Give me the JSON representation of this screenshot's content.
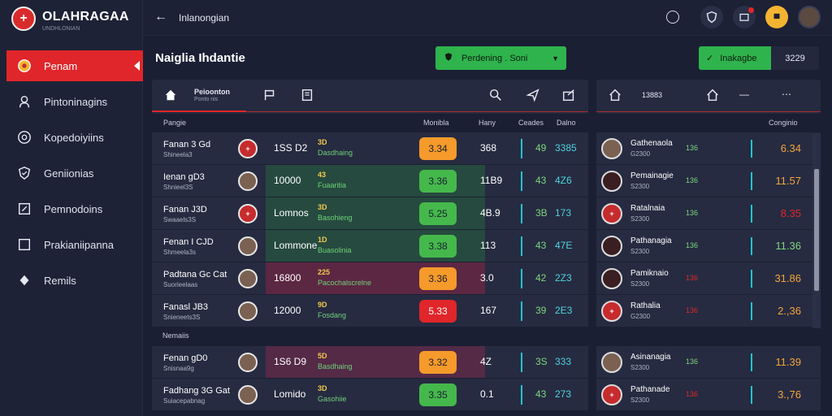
{
  "brand": {
    "name": "OLAHRAGAA",
    "tagline": "UNDHLONIAN"
  },
  "sidebar": {
    "items": [
      {
        "label": "Penam",
        "icon": "ball-icon",
        "active": true
      },
      {
        "label": "Pintoninagins",
        "icon": "user-icon",
        "active": false
      },
      {
        "label": "Kopedoiyiins",
        "icon": "soccer-icon",
        "active": false
      },
      {
        "label": "Geniionias",
        "icon": "shield-icon",
        "active": false
      },
      {
        "label": "Pemnodoins",
        "icon": "edit-icon",
        "active": false
      },
      {
        "label": "Prakianiipanna",
        "icon": "square-icon",
        "active": false
      },
      {
        "label": "Remils",
        "icon": "diamond-icon",
        "active": false
      }
    ]
  },
  "topbar": {
    "title": "Inlanongian"
  },
  "header": {
    "title": "Naiglia Ihdantie",
    "filter_label": "Perdening . Soni",
    "odds_label": "Inakagbe",
    "odds_value": "3229"
  },
  "tabs": {
    "active_label": "Peioonton",
    "active_sub": "Ponto nis"
  },
  "columns": {
    "name": "Pangie",
    "c1": "Monibla",
    "c2": "Hany",
    "c3": "Ceades",
    "c4": "Dalno",
    "right_head": "Conginio"
  },
  "right_tab_value": "13883",
  "rows": [
    {
      "name": "Fanan 3 Gd",
      "sub": "Shineela3",
      "badge": "red",
      "score": "1SS D2",
      "tag": "3D",
      "tag2": "Dasdhaing",
      "pill": "3.34",
      "pill_color": "orange",
      "v1": "368",
      "v2": "49",
      "v3": "3385",
      "hl": ""
    },
    {
      "name": "Ienan gD3",
      "sub": "Shnieel3S",
      "badge": "face",
      "score": "10000",
      "tag": "43",
      "tag2": "Fuaaritia",
      "pill": "3.36",
      "pill_color": "green",
      "v1": "11B9",
      "v2": "43",
      "v3": "4Z6",
      "hl": "green"
    },
    {
      "name": "Fanan J3D",
      "sub": "Swaaels3S",
      "badge": "red",
      "score": "Lomnos",
      "tag": "3D",
      "tag2": "Basohieng",
      "pill": "5.25",
      "pill_color": "green",
      "v1": "4B.9",
      "v2": "3B",
      "v3": "173",
      "hl": "green"
    },
    {
      "name": "Fenan I CJD",
      "sub": "Shmeela3s",
      "badge": "face",
      "score": "Lommone",
      "tag": "1D",
      "tag2": "Buasolinia",
      "pill": "3.38",
      "pill_color": "green",
      "v1": "113",
      "v2": "43",
      "v3": "47E",
      "hl": "green"
    },
    {
      "name": "Padtana Gc Cat",
      "sub": "Suorieelaas",
      "badge": "face",
      "score": "16800",
      "tag": "225",
      "tag2": "Pacochalscrelne",
      "pill": "3.36",
      "pill_color": "orange",
      "v1": "3.0",
      "v2": "42",
      "v3": "2Z3",
      "hl": "magenta"
    },
    {
      "name": "Fanasl JB3",
      "sub": "Snieneets3S",
      "badge": "face",
      "score": "12000",
      "tag": "9D",
      "tag2": "Fosdang",
      "pill": "5.33",
      "pill_color": "red",
      "v1": "167",
      "v2": "39",
      "v3": "2E3",
      "hl": ""
    }
  ],
  "section_label": "Nemaiis",
  "rows2": [
    {
      "name": "Fenan gD0",
      "sub": "Snisnaa9g",
      "badge": "face",
      "score": "1S6 D9",
      "tag": "5D",
      "tag2": "Basdhaing",
      "pill": "3.32",
      "pill_color": "orange",
      "v1": "4Z",
      "v2": "3S",
      "v3": "333",
      "hl": "plum"
    },
    {
      "name": "Fadhang 3G Gat",
      "sub": "Suiacepabnag",
      "badge": "face",
      "score": "Lomido",
      "tag": "3D",
      "tag2": "Gasohiie",
      "pill": "3.35",
      "pill_color": "green",
      "v1": "0.1",
      "v2": "43",
      "v3": "273",
      "hl": ""
    }
  ],
  "right_rows": [
    {
      "name": "Gathenaola",
      "sub": "G2300",
      "badge": "face",
      "val": "136",
      "val_color": "#7ed67d",
      "num": "6.34",
      "num_color": "#f5a43a"
    },
    {
      "name": "Pemainagie",
      "sub": "S2300",
      "badge": "dark",
      "val": "136",
      "val_color": "#7ed67d",
      "num": "11.57",
      "num_color": "#f5a43a"
    },
    {
      "name": "Ratalnaia",
      "sub": "S2300",
      "badge": "red",
      "val": "136",
      "val_color": "#7ed67d",
      "num": "8.35",
      "num_color": "#e0262a"
    },
    {
      "name": "Pathanagia",
      "sub": "S2300",
      "badge": "dark",
      "val": "136",
      "val_color": "#7ed67d",
      "num": "11.36",
      "num_color": "#7ed67d"
    },
    {
      "name": "Pamiknaio",
      "sub": "S2300",
      "badge": "dark",
      "val": "136",
      "val_color": "#e0262a",
      "num": "31.86",
      "num_color": "#f5a43a"
    },
    {
      "name": "Rathalia",
      "sub": "G2300",
      "badge": "red",
      "val": "136",
      "val_color": "#e0262a",
      "num": "2.,36",
      "num_color": "#f5a43a"
    }
  ],
  "right_rows2": [
    {
      "name": "Asinanagia",
      "sub": "S2300",
      "badge": "face",
      "val": "136",
      "val_color": "#7ed67d",
      "num": "11.39",
      "num_color": "#f5a43a"
    },
    {
      "name": "Pathanade",
      "sub": "S2300",
      "badge": "red",
      "val": "136",
      "val_color": "#e0262a",
      "num": "3.,76",
      "num_color": "#f5a43a"
    }
  ]
}
